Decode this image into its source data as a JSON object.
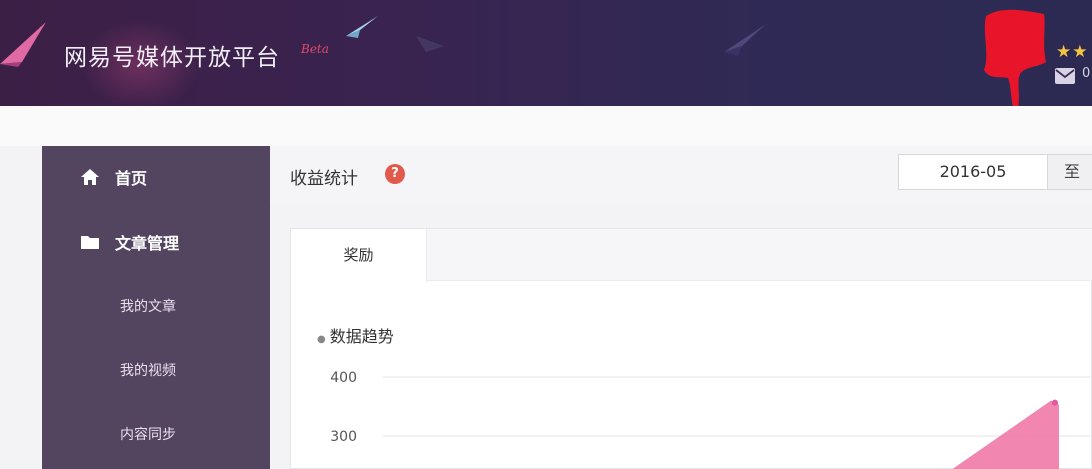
{
  "header": {
    "brand": "网易号媒体开放平台",
    "beta": "Beta",
    "stars": "★★",
    "mail_count": "0"
  },
  "sidebar": {
    "items": [
      {
        "label": "首页",
        "icon": "home-icon"
      },
      {
        "label": "文章管理",
        "icon": "folder-icon"
      }
    ],
    "sub_items": [
      {
        "label": "我的文章"
      },
      {
        "label": "我的视频"
      },
      {
        "label": "内容同步"
      }
    ]
  },
  "main": {
    "title": "收益统计",
    "help_icon": "?",
    "date_value": "2016-05",
    "to_label": "至",
    "tab": "奖励",
    "trend_title": "数据趋势"
  },
  "chart_data": {
    "type": "area",
    "y_ticks": [
      "400",
      "300"
    ],
    "values": [
      {
        "y": 360
      }
    ],
    "color": "#f07aa8"
  },
  "colors": {
    "header_bg": "#33224c",
    "sidebar_bg": "#534560",
    "accent_pink": "#f07aa8",
    "help_red": "#e0594a"
  }
}
